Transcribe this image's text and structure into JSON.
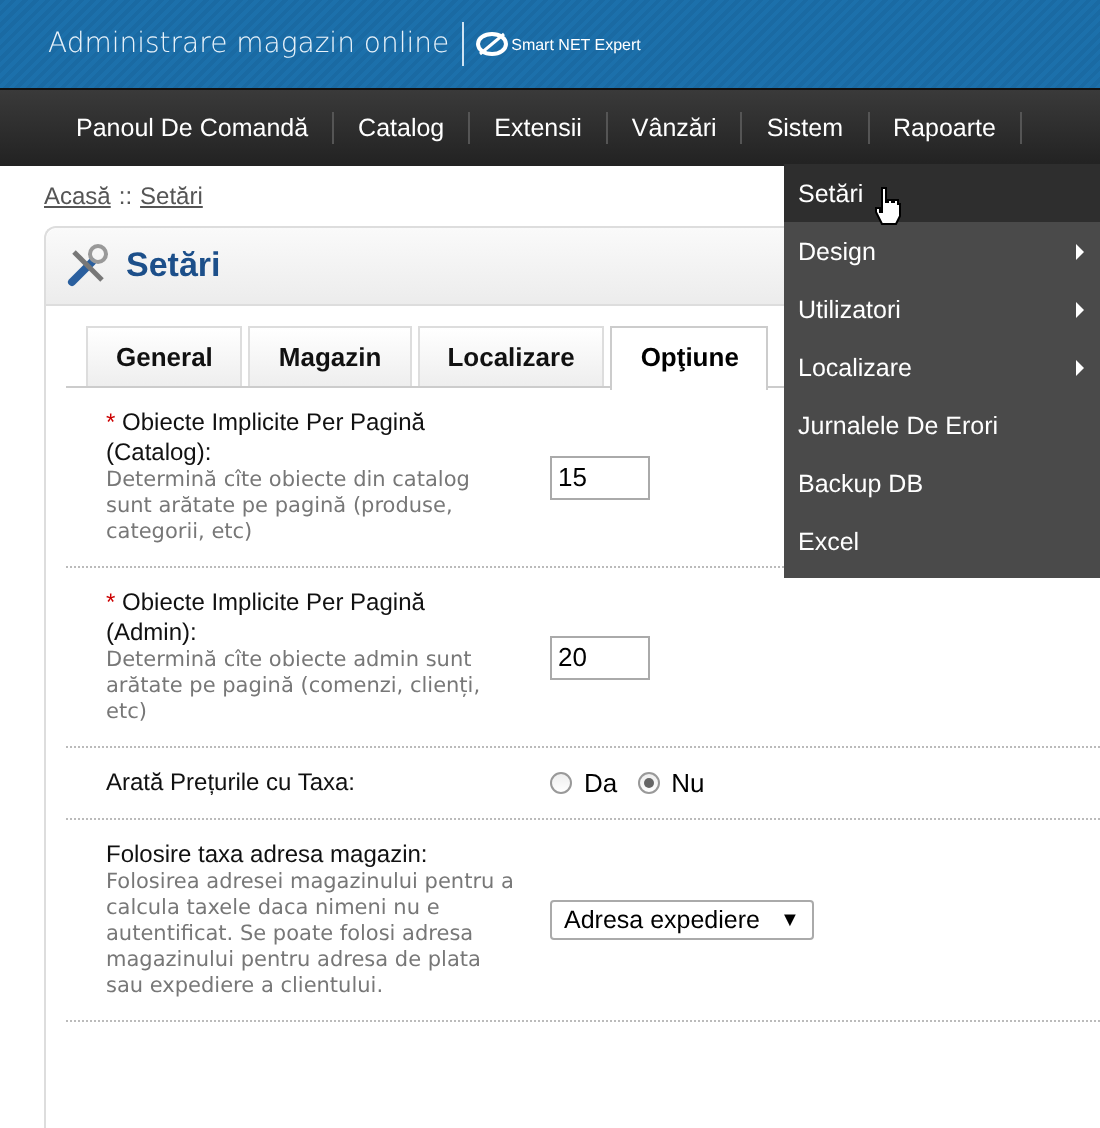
{
  "header": {
    "title": "Administrare magazin online",
    "logo_text": "Smart NET Expert"
  },
  "nav": [
    {
      "label": "Panoul De Comandă"
    },
    {
      "label": "Catalog"
    },
    {
      "label": "Extensii"
    },
    {
      "label": "Vânzări"
    },
    {
      "label": "Sistem"
    },
    {
      "label": "Rapoarte"
    }
  ],
  "dropdown": [
    {
      "label": "Setări",
      "selected": true,
      "submenu": false
    },
    {
      "label": "Design",
      "selected": false,
      "submenu": true
    },
    {
      "label": "Utilizatori",
      "selected": false,
      "submenu": true
    },
    {
      "label": "Localizare",
      "selected": false,
      "submenu": true
    },
    {
      "label": "Jurnalele De Erori",
      "selected": false,
      "submenu": false
    },
    {
      "label": "Backup DB",
      "selected": false,
      "submenu": false
    },
    {
      "label": "Excel",
      "selected": false,
      "submenu": false
    }
  ],
  "breadcrumb": [
    {
      "label": "Acasă"
    },
    {
      "label": "Setări"
    }
  ],
  "breadcrumb_separator": "::",
  "panel": {
    "title": "Setări"
  },
  "tabs": [
    {
      "label": "General",
      "selected": false
    },
    {
      "label": "Magazin",
      "selected": false
    },
    {
      "label": "Localizare",
      "selected": false
    },
    {
      "label": "Opţiune",
      "selected": true
    }
  ],
  "rows": [
    {
      "kind": "text",
      "required": true,
      "label": "Obiecte Implicite Per Pagină (Catalog):",
      "help": "Determină cîte obiecte din catalog sunt arătate pe pagină (produse, categorii, etc)",
      "value": "15"
    },
    {
      "kind": "text",
      "required": true,
      "label": "Obiecte Implicite Per Pagină (Admin):",
      "help": "Determină cîte obiecte admin sunt arătate pe pagină (comenzi, clienți, etc)",
      "value": "20"
    },
    {
      "kind": "radio",
      "required": false,
      "label": "Arată Prețurile cu Taxa:",
      "options": [
        {
          "label": "Da",
          "selected": false
        },
        {
          "label": "Nu",
          "selected": true
        }
      ]
    },
    {
      "kind": "select",
      "required": false,
      "label": "Folosire taxa adresa magazin:",
      "help": "Folosirea adresei magazinului pentru a calcula taxele daca nimeni nu e autentificat. Se poate folosi adresa magazinului pentru adresa de plata sau expediere a clientului.",
      "value": "Adresa expediere",
      "caret": "▼"
    }
  ],
  "required_mark": "*"
}
